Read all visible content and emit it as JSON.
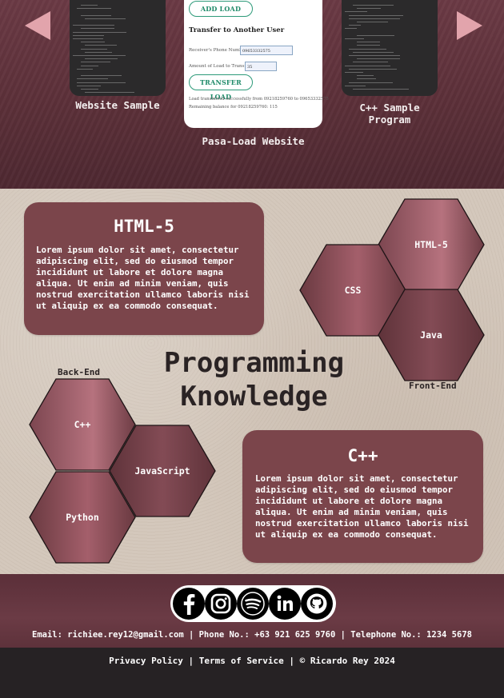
{
  "carousel": {
    "left_label": "Website Sample",
    "center_label": "Pasa-Load Website",
    "right_label": "C++ Sample Program",
    "card": {
      "add_load_button": "ADD LOAD",
      "transfer_heading": "Transfer to Another User",
      "receiver_label": "Receiver's Phone Number:",
      "receiver_value": "09653332575",
      "amount_label": "Amount of Load to Transfer:",
      "amount_value": "35",
      "transfer_button": "TRANSFER LOAD",
      "message_1": "Load transferred successfully from 09218259760 to 09653332575",
      "message_2": "Remaining balance for 09218259760: 115"
    }
  },
  "knowledge": {
    "title_line1": "Programming",
    "title_line2": "Knowledge",
    "html_card": {
      "title": "HTML-5",
      "body": "Lorem ipsum dolor sit amet, consectetur adipiscing elit, sed do eiusmod tempor incididunt ut labore et dolore magna aliqua. Ut enim ad minim veniam, quis nostrud exercitation ullamco laboris nisi ut aliquip ex ea commodo consequat."
    },
    "cpp_card": {
      "title": "C++",
      "body": "Lorem ipsum dolor sit amet, consectetur adipiscing elit, sed do eiusmod tempor incididunt ut labore et dolore magna aliqua. Ut enim ad minim veniam, quis nostrud exercitation ullamco laboris nisi ut aliquip ex ea commodo consequat."
    },
    "front_end": {
      "label": "Front-End",
      "items": [
        "HTML-5",
        "CSS",
        "Java"
      ]
    },
    "back_end": {
      "label": "Back-End",
      "items": [
        "C++",
        "JavaScript",
        "Python"
      ]
    }
  },
  "footer": {
    "social_icons": [
      "facebook-icon",
      "instagram-icon",
      "spotify-icon",
      "linkedin-icon",
      "github-icon"
    ],
    "contact": "Email: richiee.rey12@gmail.com | Phone No.: +63 921 625 9760 | Telephone No.: 1234 5678",
    "privacy": "Privacy Policy",
    "terms": "Terms of Service",
    "copyright": "© Ricardo Rey 2024",
    "separator": " | "
  },
  "colors": {
    "accent": "#7b454b",
    "hex_light": "#b06d79",
    "footer": "#5b2f39",
    "button_green": "#2d9a79"
  }
}
